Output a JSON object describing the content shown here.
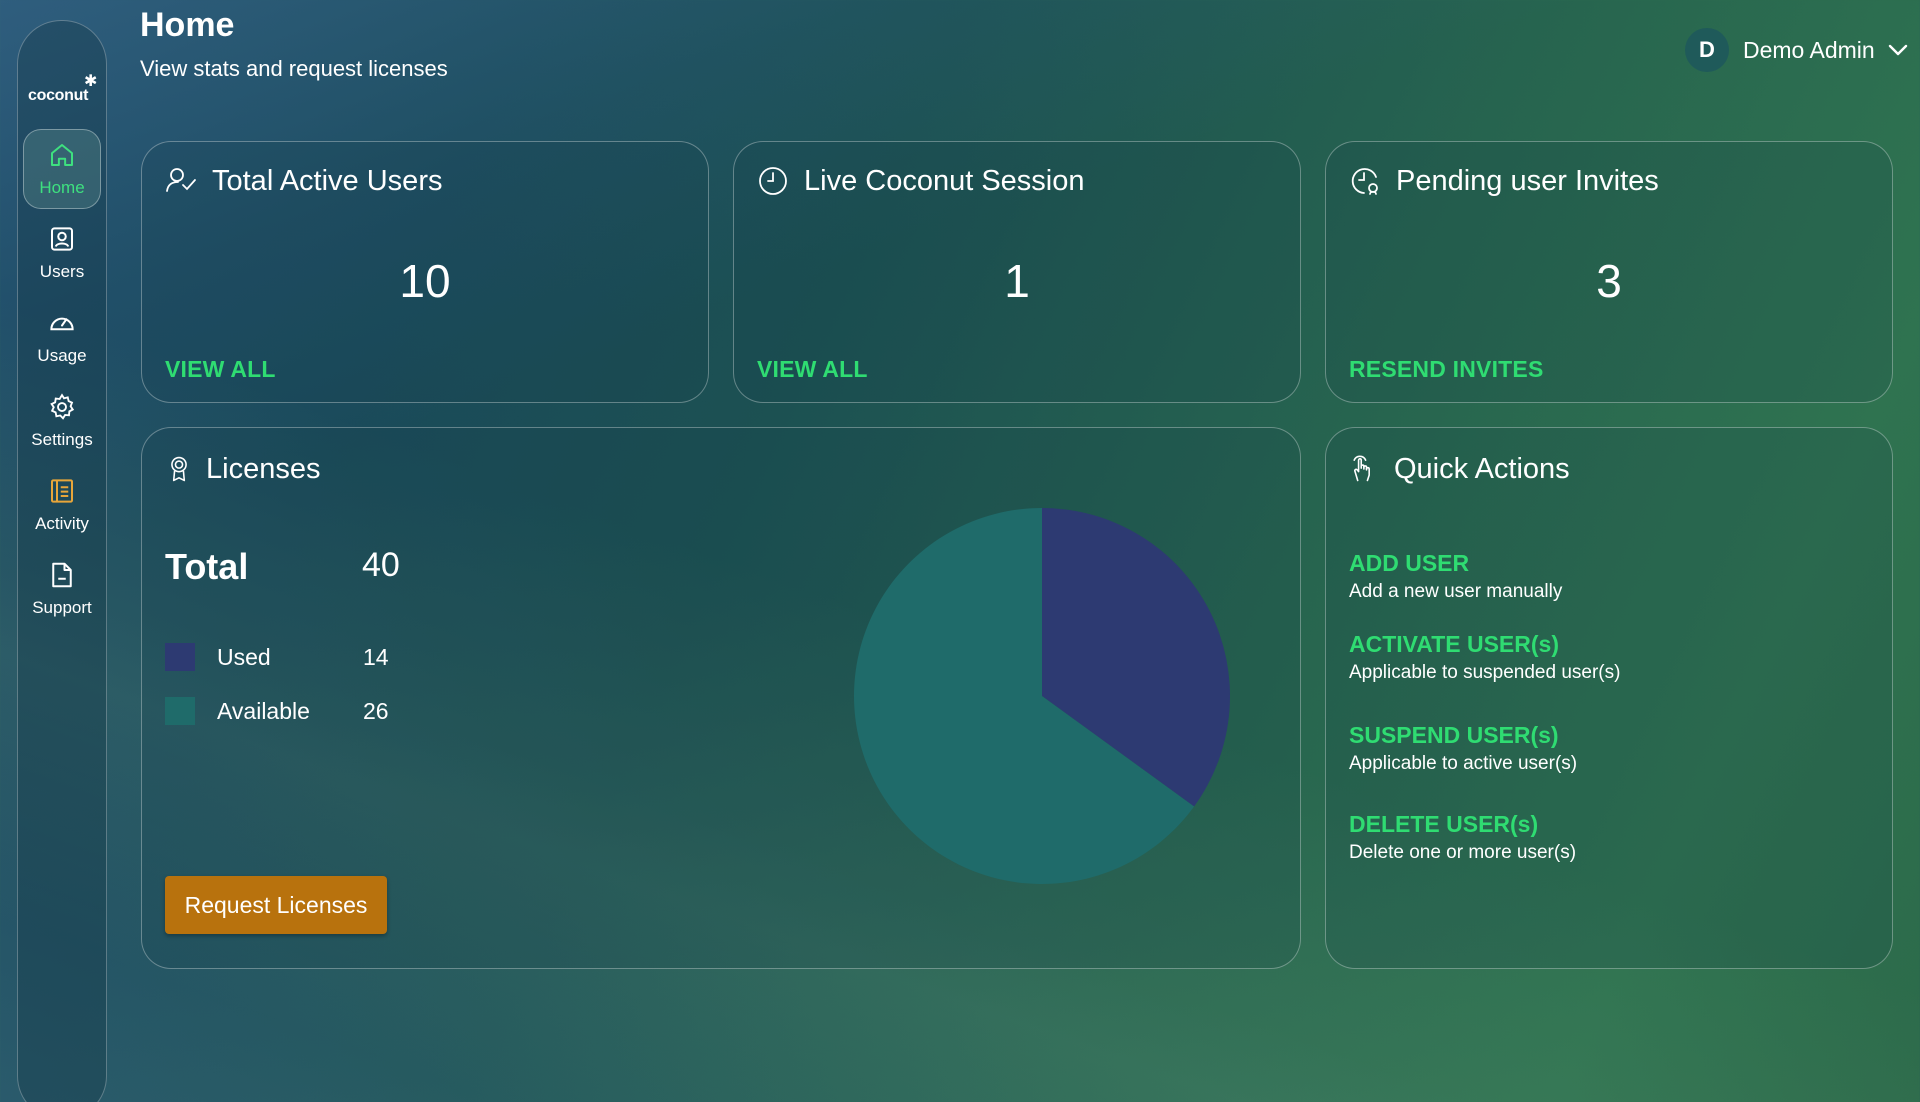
{
  "app": {
    "logo_text": "coconut"
  },
  "sidebar": {
    "items": [
      {
        "label": "Home",
        "icon": "home-icon",
        "active": true
      },
      {
        "label": "Users",
        "icon": "user-icon",
        "active": false
      },
      {
        "label": "Usage",
        "icon": "gauge-icon",
        "active": false
      },
      {
        "label": "Settings",
        "icon": "gear-icon",
        "active": false
      },
      {
        "label": "Activity",
        "icon": "list-icon",
        "active": false
      },
      {
        "label": "Support",
        "icon": "document-icon",
        "active": false
      }
    ]
  },
  "header": {
    "title": "Home",
    "subtitle": "View stats and request licenses",
    "user_initial": "D",
    "user_name": "Demo Admin"
  },
  "stats": [
    {
      "title": "Total Active Users",
      "icon": "user-check-icon",
      "value": "10",
      "link": "VIEW ALL"
    },
    {
      "title": "Live Coconut Session",
      "icon": "clock-icon",
      "value": "1",
      "link": "VIEW ALL"
    },
    {
      "title": "Pending user Invites",
      "icon": "pending-clock-icon",
      "value": "3",
      "link": "RESEND INVITES"
    }
  ],
  "licenses": {
    "title": "Licenses",
    "total_label": "Total",
    "total_value": "40",
    "legend": [
      {
        "label": "Used",
        "value": "14",
        "color": "#2d3a72"
      },
      {
        "label": "Available",
        "value": "26",
        "color": "#1f6b6a"
      }
    ],
    "button_label": "Request Licenses"
  },
  "chart_data": {
    "type": "pie",
    "categories": [
      "Used",
      "Available"
    ],
    "values": [
      14,
      26
    ],
    "colors": [
      "#2d3a72",
      "#1f6b6a"
    ]
  },
  "quick_actions": {
    "title": "Quick Actions",
    "items": [
      {
        "title": "ADD USER",
        "desc": "Add a new user manually"
      },
      {
        "title": "ACTIVATE USER(s)",
        "desc": "Applicable to suspended user(s)"
      },
      {
        "title": "SUSPEND USER(s)",
        "desc": "Applicable to active user(s)"
      },
      {
        "title": "DELETE USER(s)",
        "desc": "Delete one or more user(s)"
      }
    ]
  },
  "colors": {
    "accent": "#2fdc72",
    "button": "#b8720d"
  }
}
